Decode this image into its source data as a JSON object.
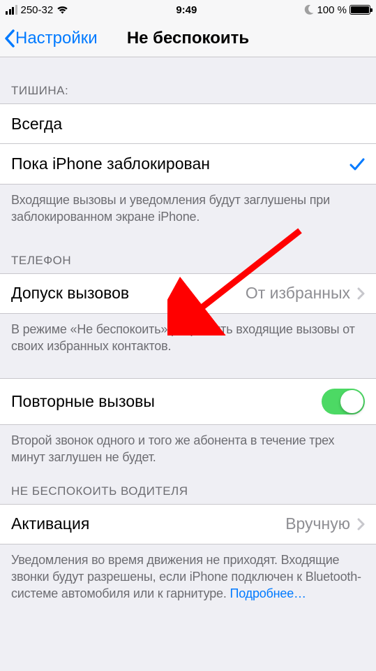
{
  "status_bar": {
    "carrier": "250-32",
    "time": "9:49",
    "battery_text": "100 %",
    "battery_fill_pct": 100
  },
  "nav": {
    "back_label": "Настройки",
    "title": "Не беспокоить"
  },
  "sections": {
    "silence": {
      "header": "ТИШИНА:",
      "always": "Всегда",
      "while_locked": "Пока iPhone заблокирован",
      "footer": "Входящие вызовы и уведомления будут заглушены при заблокированном экране iPhone."
    },
    "phone": {
      "header": "ТЕЛЕФОН",
      "allow_calls_label": "Допуск вызовов",
      "allow_calls_value": "От избранных",
      "footer": "В режиме «Не беспокоить» разрешить входящие вызовы от своих избранных контактов."
    },
    "repeated": {
      "label": "Повторные вызовы",
      "footer": "Второй звонок одного и того же абонента в течение трех минут заглушен не будет."
    },
    "driving": {
      "header": "НЕ БЕСПОКОИТЬ ВОДИТЕЛЯ",
      "activate_label": "Активация",
      "activate_value": "Вручную",
      "footer": "Уведомления во время движения не приходят. Входящие звонки будут разрешены, если iPhone подключен к Bluetooth-системе автомобиля или к гарнитуре. ",
      "learn_more": "Подробнее…"
    }
  }
}
